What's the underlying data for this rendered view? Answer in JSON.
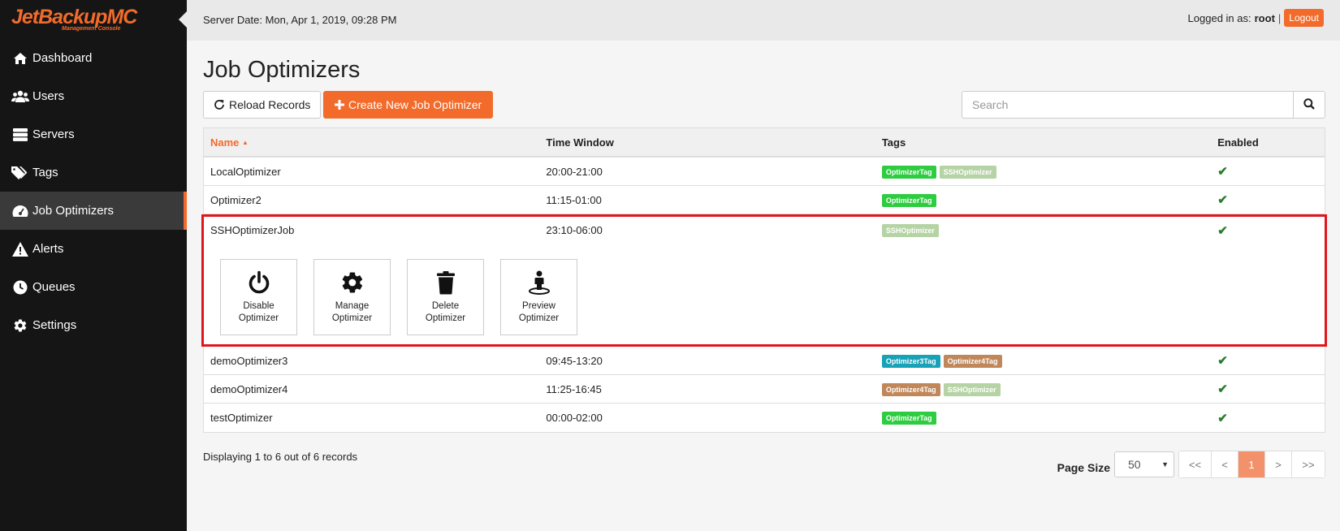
{
  "logo": {
    "main": "JetBackupMC",
    "sub": "Management Console"
  },
  "sidebar": {
    "items": [
      {
        "label": "Dashboard",
        "icon": "home-icon"
      },
      {
        "label": "Users",
        "icon": "users-icon"
      },
      {
        "label": "Servers",
        "icon": "servers-icon"
      },
      {
        "label": "Tags",
        "icon": "tags-icon"
      },
      {
        "label": "Job Optimizers",
        "icon": "dashboard-gauge-icon",
        "active": true
      },
      {
        "label": "Alerts",
        "icon": "alert-icon"
      },
      {
        "label": "Queues",
        "icon": "clock-icon"
      },
      {
        "label": "Settings",
        "icon": "gear-icon"
      }
    ]
  },
  "header": {
    "server_date": "Server Date: Mon, Apr 1, 2019, 09:28 PM",
    "logged_in_prefix": "Logged in as:",
    "username": "root",
    "separator": "|",
    "logout_label": "Logout"
  },
  "page": {
    "title": "Job Optimizers",
    "reload_label": "Reload Records",
    "create_label": "Create New Job Optimizer",
    "search_placeholder": "Search"
  },
  "table": {
    "columns": {
      "name": "Name",
      "time_window": "Time Window",
      "tags": "Tags",
      "enabled": "Enabled"
    },
    "sort_indicator": "▲",
    "rows": [
      {
        "name": "LocalOptimizer",
        "time_window": "20:00-21:00",
        "tags": [
          "OptimizerTag",
          "SSHOptimizer"
        ],
        "enabled": "✔"
      },
      {
        "name": "Optimizer2",
        "time_window": "11:15-01:00",
        "tags": [
          "OptimizerTag"
        ],
        "enabled": "✔"
      },
      {
        "name": "SSHOptimizerJob",
        "time_window": "23:10-06:00",
        "tags": [
          "SSHOptimizer"
        ],
        "enabled": "✔"
      },
      {
        "name": "demoOptimizer3",
        "time_window": "09:45-13:20",
        "tags": [
          "Optimizer3Tag",
          "Optimizer4Tag"
        ],
        "enabled": "✔"
      },
      {
        "name": "demoOptimizer4",
        "time_window": "11:25-16:45",
        "tags": [
          "Optimizer4Tag",
          "SSHOptimizer"
        ],
        "enabled": "✔"
      },
      {
        "name": "testOptimizer",
        "time_window": "00:00-02:00",
        "tags": [
          "OptimizerTag"
        ],
        "enabled": "✔"
      }
    ],
    "actions": [
      {
        "line1": "Disable",
        "line2": "Optimizer",
        "icon": "power-icon"
      },
      {
        "line1": "Manage",
        "line2": "Optimizer",
        "icon": "gear-icon"
      },
      {
        "line1": "Delete",
        "line2": "Optimizer",
        "icon": "trash-icon"
      },
      {
        "line1": "Preview",
        "line2": "Optimizer",
        "icon": "street-view-icon"
      }
    ]
  },
  "tag_colors": {
    "OptimizerTag": "#2ecc40",
    "SSHOptimizer": "#b5d3a4",
    "Optimizer3Tag": "#17a2b8",
    "Optimizer4Tag": "#c0875a"
  },
  "footer": {
    "records_info": "Displaying 1 to 6 out of 6 records",
    "page_size_label": "Page Size",
    "page_size_value": "50",
    "pager": {
      "first": "<<",
      "prev": "<",
      "current": "1",
      "next": ">",
      "last": ">>"
    }
  },
  "colors": {
    "accent": "#f26b2a",
    "sidebar_bg": "#151515",
    "highlight_border": "#e0161b",
    "check": "#2a7d2e"
  }
}
